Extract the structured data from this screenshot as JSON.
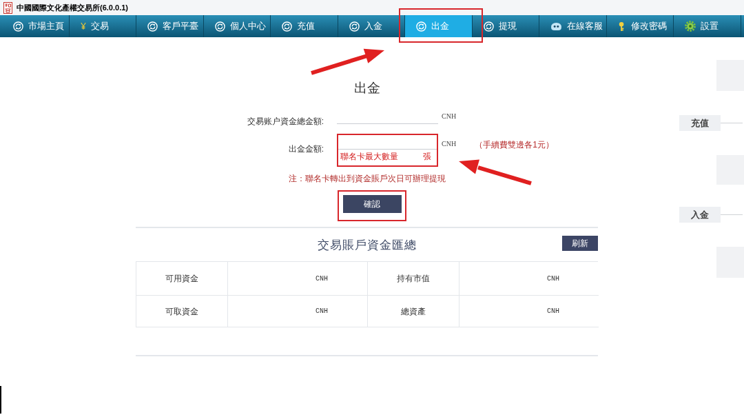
{
  "window": {
    "title": "中國國際文化產權交易所(6.0.0.1)"
  },
  "nav": [
    {
      "label": "市場主頁",
      "kind": "cycle",
      "selected": false,
      "highlighted": false
    },
    {
      "label": "交易",
      "kind": "yen",
      "selected": false,
      "highlighted": false
    },
    {
      "label": "客戶平臺",
      "kind": "cycle",
      "selected": false,
      "highlighted": false
    },
    {
      "label": "個人中心",
      "kind": "cycle",
      "selected": false,
      "highlighted": false
    },
    {
      "label": "充值",
      "kind": "cycle",
      "selected": false,
      "highlighted": false
    },
    {
      "label": "入金",
      "kind": "cycle",
      "selected": false,
      "highlighted": false
    },
    {
      "label": "出金",
      "kind": "cycle",
      "selected": true,
      "highlighted": true
    },
    {
      "label": "提現",
      "kind": "cycle",
      "selected": false,
      "highlighted": false
    },
    {
      "label": "在線客服",
      "kind": "face",
      "selected": false,
      "highlighted": false
    },
    {
      "label": "修改密碼",
      "kind": "key",
      "selected": false,
      "highlighted": false
    },
    {
      "label": "設置",
      "kind": "gear",
      "selected": false,
      "highlighted": false
    }
  ],
  "withdraw_form": {
    "title": "出金",
    "fields": [
      {
        "label": "交易账户資金總金額:",
        "unit": "CNH",
        "highlighted": false
      },
      {
        "label": "出金金額:",
        "unit": "CNH",
        "highlighted": true,
        "sub_label": "聯名卡最大數量",
        "sub_unit": "張",
        "note": "（手續費雙邊各1元）"
      }
    ],
    "notice": "注：聯名卡轉出到資金賬戶次日可辦理提現",
    "submit": {
      "label": "確認",
      "highlighted": true
    }
  },
  "summary": {
    "title": "交易賬戶資金匯總",
    "refresh_button": "刷新",
    "rows": [
      {
        "cells": [
          {
            "kind": "label",
            "text": "可用資金"
          },
          {
            "kind": "value",
            "text": "CNH"
          },
          {
            "kind": "label",
            "text": "持有市值"
          },
          {
            "kind": "value",
            "text": "CNH"
          }
        ]
      },
      {
        "cells": [
          {
            "kind": "label",
            "text": "可取資金"
          },
          {
            "kind": "value",
            "text": "CNH"
          },
          {
            "kind": "label",
            "text": "總資產"
          },
          {
            "kind": "value",
            "text": "CNH"
          }
        ]
      }
    ]
  },
  "side_panel": {
    "steps": [
      {
        "label": "充值"
      },
      {
        "label": "入金"
      }
    ]
  }
}
